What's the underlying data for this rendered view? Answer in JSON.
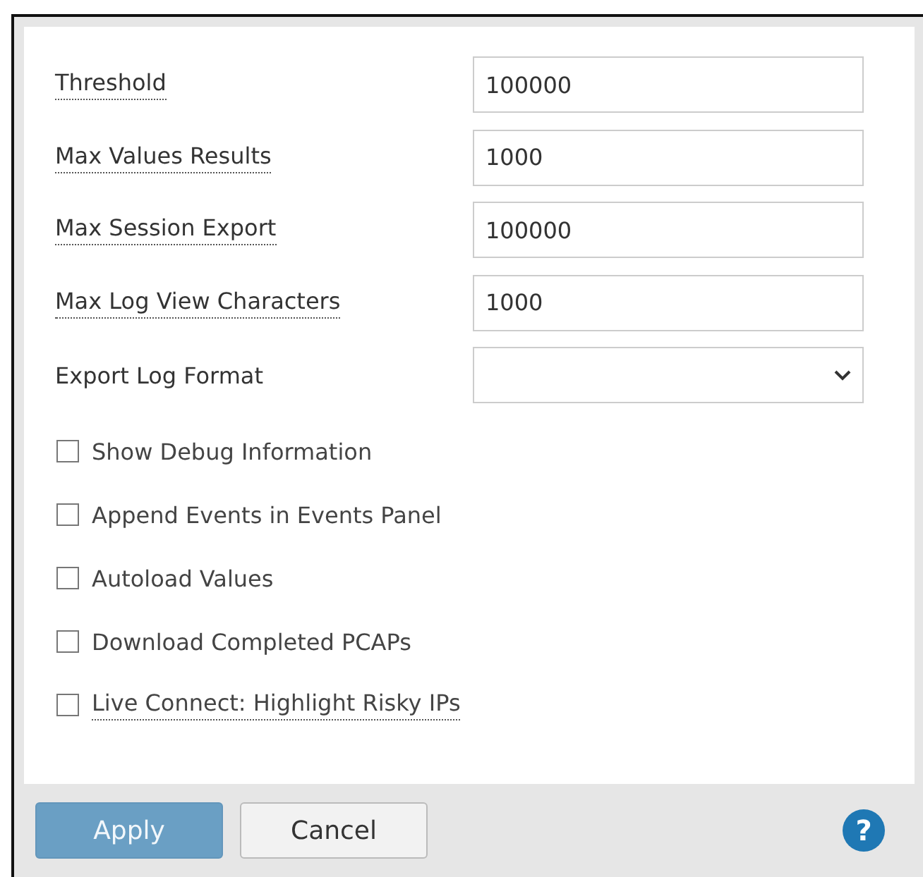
{
  "fields": [
    {
      "label": "Threshold",
      "tooltip": true,
      "kind": "text",
      "value": "100000"
    },
    {
      "label": "Max Values Results",
      "tooltip": true,
      "kind": "text",
      "value": "1000"
    },
    {
      "label": "Max Session Export",
      "tooltip": true,
      "kind": "text",
      "value": "100000"
    },
    {
      "label": "Max Log View Characters",
      "tooltip": true,
      "kind": "text",
      "value": "1000"
    },
    {
      "label": "Export Log Format",
      "tooltip": false,
      "kind": "select"
    }
  ],
  "options": [
    {
      "label": "Show Debug Information",
      "checked": false,
      "tooltip": false
    },
    {
      "label": "Append Events in Events Panel",
      "checked": false,
      "tooltip": false
    },
    {
      "label": "Autoload Values",
      "checked": false,
      "tooltip": false
    },
    {
      "label": "Download Completed PCAPs",
      "checked": false,
      "tooltip": false
    },
    {
      "label": "Live Connect: Highlight Risky IPs",
      "checked": false,
      "tooltip": true
    }
  ],
  "buttons": [
    {
      "label": "Apply",
      "kind": "primary",
      "disabled": true
    },
    {
      "label": "Cancel",
      "kind": "secondary",
      "disabled": false
    }
  ],
  "help": {
    "label": "?"
  }
}
